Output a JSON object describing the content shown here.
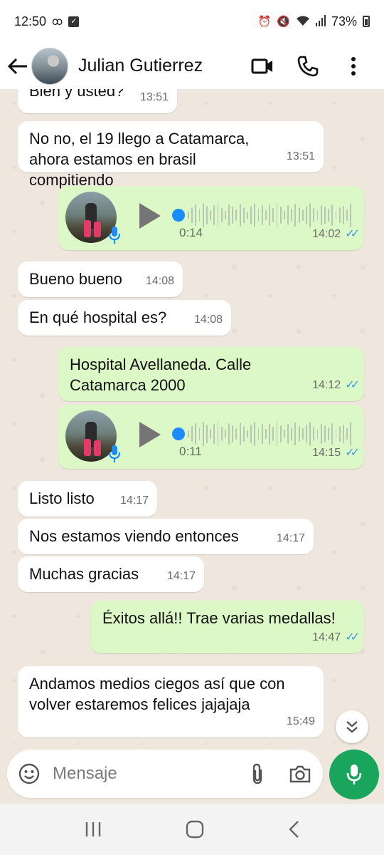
{
  "status": {
    "time": "12:50",
    "battery": "73%"
  },
  "header": {
    "contact_name": "Julian Gutierrez"
  },
  "messages": [
    {
      "dir": "in",
      "text": "Bien y usted?",
      "time": "13:51"
    },
    {
      "dir": "in",
      "text": "No no, el 19 llego a Catamarca, ahora estamos en brasil compitiendo",
      "time": "13:51"
    },
    {
      "dir": "out",
      "type": "voice",
      "duration": "0:14",
      "time": "14:02"
    },
    {
      "dir": "in",
      "text": "Bueno bueno",
      "time": "14:08"
    },
    {
      "dir": "in",
      "text": "En qué hospital es?",
      "time": "14:08"
    },
    {
      "dir": "out",
      "text": "Hospital Avellaneda. Calle Catamarca 2000",
      "time": "14:12"
    },
    {
      "dir": "out",
      "type": "voice",
      "duration": "0:11",
      "time": "14:15"
    },
    {
      "dir": "in",
      "text": "Listo listo",
      "time": "14:17"
    },
    {
      "dir": "in",
      "text": "Nos estamos viendo entonces",
      "time": "14:17"
    },
    {
      "dir": "in",
      "text": "Muchas gracias",
      "time": "14:17"
    },
    {
      "dir": "out",
      "text": "Éxitos allá!! Trae varias medallas!",
      "time": "14:47"
    },
    {
      "dir": "in",
      "text": "Andamos medios ciegos así que con volver estaremos felices jajajaja",
      "time": "15:49"
    }
  ],
  "composer": {
    "placeholder": "Mensaje"
  },
  "colors": {
    "accent": "#1aa55d",
    "outgoing_bubble": "#dcf8c6",
    "incoming_bubble": "#ffffff",
    "read_ticks": "#3b9be8"
  }
}
